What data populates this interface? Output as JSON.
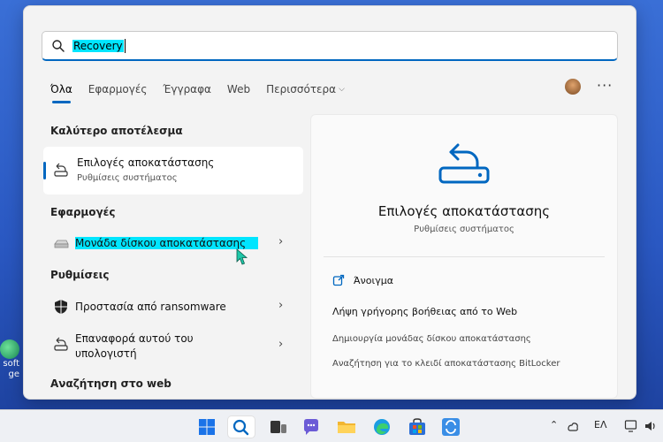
{
  "search": {
    "value": "Recovery"
  },
  "tabs": [
    {
      "label": "Όλα"
    },
    {
      "label": "Εφαρμογές"
    },
    {
      "label": "Έγγραφα"
    },
    {
      "label": "Web"
    },
    {
      "label": "Περισσότερα"
    }
  ],
  "sections": {
    "best": "Καλύτερο αποτέλεσμα",
    "apps": "Εφαρμογές",
    "settings": "Ρυθμίσεις",
    "web": "Αναζήτηση στο web"
  },
  "best_result": {
    "title": "Επιλογές αποκατάστασης",
    "subtitle": "Ρυθμίσεις συστήματος"
  },
  "apps": [
    {
      "title": "Μονάδα δίσκου αποκατάστασης"
    }
  ],
  "settings": [
    {
      "title": "Προστασία από ransomware"
    },
    {
      "title_line1": "Επαναφορά αυτού του",
      "title_line2": "υπολογιστή"
    }
  ],
  "preview": {
    "title": "Επιλογές αποκατάστασης",
    "subtitle": "Ρυθμίσεις συστήματος",
    "open_label": "Άνοιγμα",
    "web_help": "Λήψη γρήγορης βοήθειας από το Web",
    "links": [
      "Δημιουργία μονάδας δίσκου αποκατάστασης",
      "Αναζήτηση για το κλειδί αποκατάστασης BitLocker"
    ]
  },
  "desktop": {
    "label_line1": "soft",
    "label_line2": "ge"
  },
  "tray": {
    "language": "ΕΛ"
  },
  "colors": {
    "accent": "#0067c0",
    "highlight": "#00e5ff"
  }
}
